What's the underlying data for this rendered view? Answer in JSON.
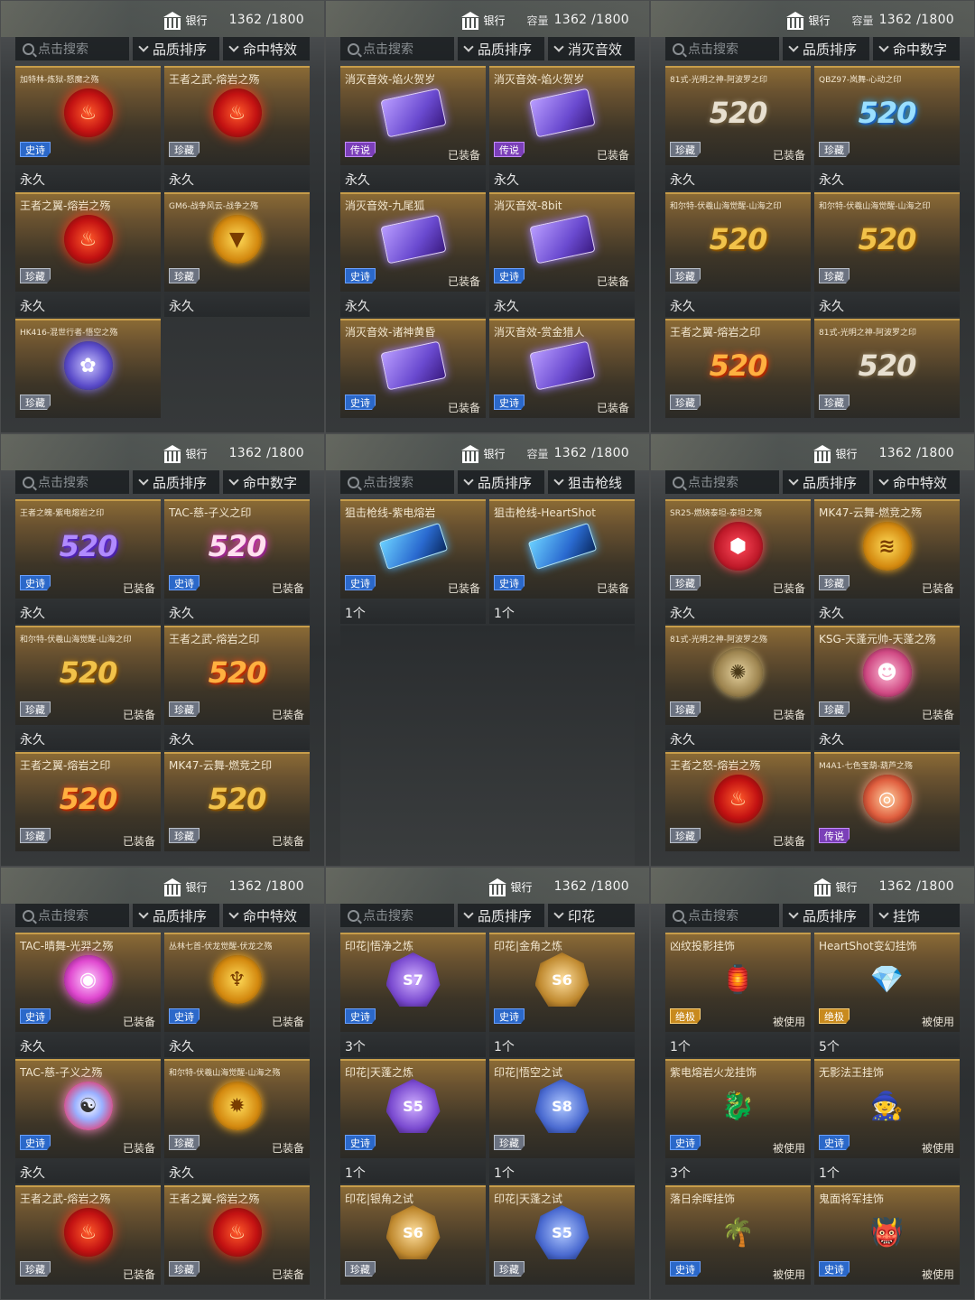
{
  "panels": [
    {
      "bank": "银行",
      "capacity_label": "",
      "capacity": "1362 /1800",
      "search_placeholder": "点击搜索",
      "sort": "品质排序",
      "filter": "命中特效",
      "cards": [
        {
          "name": "加特林-炼狱-怒魔之殇",
          "small": true,
          "art": "emblem",
          "cls": "e-fire",
          "glyph": "♨",
          "badge": "史诗",
          "badge_cls": "b-shishi",
          "equip": "",
          "foot": "永久"
        },
        {
          "name": "王者之武-熔岩之殇",
          "small": false,
          "art": "emblem",
          "cls": "e-fire",
          "glyph": "♨",
          "badge": "珍藏",
          "badge_cls": "b-zhencang",
          "equip": "",
          "foot": "永久"
        },
        {
          "name": "王者之翼-熔岩之殇",
          "small": false,
          "art": "emblem",
          "cls": "e-fire",
          "glyph": "♨",
          "badge": "珍藏",
          "badge_cls": "b-zhencang",
          "equip": "",
          "foot": "永久"
        },
        {
          "name": "GM6-战争风云-战争之殇",
          "small": true,
          "art": "emblem",
          "cls": "e-gold",
          "glyph": "▼",
          "badge": "珍藏",
          "badge_cls": "b-zhencang",
          "equip": "",
          "foot": "永久"
        },
        {
          "name": "HK416-混世行者-悟空之殇",
          "small": true,
          "art": "emblem",
          "cls": "e-blue",
          "glyph": "✿",
          "badge": "珍藏",
          "badge_cls": "b-zhencang",
          "equip": "",
          "foot": ""
        }
      ]
    },
    {
      "bank": "银行",
      "capacity_label": "容量",
      "capacity": "1362 /1800",
      "search_placeholder": "点击搜索",
      "sort": "品质排序",
      "filter": "消灭音效",
      "cards": [
        {
          "name": "消灭音效-焰火贺岁",
          "small": false,
          "art": "sfx",
          "cls": "",
          "glyph": "",
          "badge": "传说",
          "badge_cls": "b-chuanshuo",
          "equip": "已装备",
          "foot": "永久"
        },
        {
          "name": "消灭音效-焰火贺岁",
          "small": false,
          "art": "sfx",
          "cls": "",
          "glyph": "",
          "badge": "传说",
          "badge_cls": "b-chuanshuo",
          "equip": "已装备",
          "foot": "永久"
        },
        {
          "name": "消灭音效-九尾狐",
          "small": false,
          "art": "sfx",
          "cls": "",
          "glyph": "",
          "badge": "史诗",
          "badge_cls": "b-shishi",
          "equip": "已装备",
          "foot": "永久"
        },
        {
          "name": "消灭音效-8bit",
          "small": false,
          "art": "sfx",
          "cls": "",
          "glyph": "",
          "badge": "史诗",
          "badge_cls": "b-shishi",
          "equip": "已装备",
          "foot": "永久"
        },
        {
          "name": "消灭音效-诸神黄昏",
          "small": false,
          "art": "sfx",
          "cls": "",
          "glyph": "",
          "badge": "史诗",
          "badge_cls": "b-shishi",
          "equip": "已装备",
          "foot": ""
        },
        {
          "name": "消灭音效-赏金猎人",
          "small": false,
          "art": "sfx",
          "cls": "",
          "glyph": "",
          "badge": "史诗",
          "badge_cls": "b-shishi",
          "equip": "已装备",
          "foot": ""
        }
      ]
    },
    {
      "bank": "银行",
      "capacity_label": "容量",
      "capacity": "1362 /1800",
      "search_placeholder": "点击搜索",
      "sort": "品质排序",
      "filter": "命中数字",
      "cards": [
        {
          "name": "81式-光明之神-阿波罗之印",
          "small": true,
          "art": "num",
          "cls": "t-silver",
          "glyph": "520",
          "badge": "珍藏",
          "badge_cls": "b-zhencang",
          "equip": "已装备",
          "foot": "永久"
        },
        {
          "name": "QBZ97-岚舞-心动之印",
          "small": true,
          "art": "num",
          "cls": "t-blue",
          "glyph": "520",
          "badge": "珍藏",
          "badge_cls": "b-zhencang",
          "equip": "",
          "foot": "永久"
        },
        {
          "name": "和尔特-伏羲山海觉醒-山海之印",
          "small": true,
          "art": "num",
          "cls": "t-gold",
          "glyph": "520",
          "badge": "珍藏",
          "badge_cls": "b-zhencang",
          "equip": "",
          "foot": "永久"
        },
        {
          "name": "和尔特-伏羲山海觉醒-山海之印",
          "small": true,
          "art": "num",
          "cls": "t-gold",
          "glyph": "520",
          "badge": "珍藏",
          "badge_cls": "b-zhencang",
          "equip": "",
          "foot": "永久"
        },
        {
          "name": "王者之翼-熔岩之印",
          "small": false,
          "art": "num",
          "cls": "t-orange",
          "glyph": "520",
          "badge": "珍藏",
          "badge_cls": "b-zhencang",
          "equip": "",
          "foot": ""
        },
        {
          "name": "81式-光明之神-阿波罗之印",
          "small": true,
          "art": "num",
          "cls": "t-silver",
          "glyph": "520",
          "badge": "珍藏",
          "badge_cls": "b-zhencang",
          "equip": "",
          "foot": ""
        }
      ]
    },
    {
      "bank": "银行",
      "capacity_label": "",
      "capacity": "1362 /1800",
      "search_placeholder": "点击搜索",
      "sort": "品质排序",
      "filter": "命中数字",
      "cards": [
        {
          "name": "王者之魄-紫电熔岩之印",
          "small": true,
          "art": "num",
          "cls": "t-purple",
          "glyph": "520",
          "badge": "史诗",
          "badge_cls": "b-shishi",
          "equip": "已装备",
          "foot": "永久"
        },
        {
          "name": "TAC-慈-子义之印",
          "small": false,
          "art": "num",
          "cls": "t-pink",
          "glyph": "520",
          "badge": "史诗",
          "badge_cls": "b-shishi",
          "equip": "已装备",
          "foot": "永久"
        },
        {
          "name": "和尔特-伏羲山海觉醒-山海之印",
          "small": true,
          "art": "num",
          "cls": "t-gold",
          "glyph": "520",
          "badge": "珍藏",
          "badge_cls": "b-zhencang",
          "equip": "已装备",
          "foot": "永久"
        },
        {
          "name": "王者之武-熔岩之印",
          "small": false,
          "art": "num",
          "cls": "t-orange",
          "glyph": "520",
          "badge": "珍藏",
          "badge_cls": "b-zhencang",
          "equip": "已装备",
          "foot": "永久"
        },
        {
          "name": "王者之翼-熔岩之印",
          "small": false,
          "art": "num",
          "cls": "t-orange",
          "glyph": "520",
          "badge": "珍藏",
          "badge_cls": "b-zhencang",
          "equip": "已装备",
          "foot": ""
        },
        {
          "name": "MK47-云舞-燃竞之印",
          "small": false,
          "art": "num",
          "cls": "t-gold",
          "glyph": "520",
          "badge": "珍藏",
          "badge_cls": "b-zhencang",
          "equip": "已装备",
          "foot": ""
        }
      ]
    },
    {
      "bank": "银行",
      "capacity_label": "容量",
      "capacity": "1362 /1800",
      "search_placeholder": "点击搜索",
      "sort": "品质排序",
      "filter": "狙击枪线",
      "cards": [
        {
          "name": "狙击枪线-紫电熔岩",
          "small": false,
          "art": "snipe",
          "cls": "",
          "glyph": "",
          "badge": "史诗",
          "badge_cls": "b-shishi",
          "equip": "已装备",
          "foot": "1个"
        },
        {
          "name": "狙击枪线-HeartShot",
          "small": false,
          "art": "snipe",
          "cls": "",
          "glyph": "",
          "badge": "史诗",
          "badge_cls": "b-shishi",
          "equip": "已装备",
          "foot": "1个"
        }
      ]
    },
    {
      "bank": "银行",
      "capacity_label": "",
      "capacity": "1362 /1800",
      "search_placeholder": "点击搜索",
      "sort": "品质排序",
      "filter": "命中特效",
      "cards": [
        {
          "name": "SR25-燃烧泰坦-泰坦之殇",
          "small": true,
          "art": "emblem",
          "cls": "e-red2",
          "glyph": "⬢",
          "badge": "珍藏",
          "badge_cls": "b-zhencang",
          "equip": "已装备",
          "foot": "永久"
        },
        {
          "name": "MK47-云舞-燃竞之殇",
          "small": false,
          "art": "emblem",
          "cls": "e-gold",
          "glyph": "≋",
          "badge": "珍藏",
          "badge_cls": "b-zhencang",
          "equip": "已装备",
          "foot": "永久"
        },
        {
          "name": "81式-光明之神-阿波罗之殇",
          "small": true,
          "art": "emblem",
          "cls": "e-bronze",
          "glyph": "✺",
          "badge": "珍藏",
          "badge_cls": "b-zhencang",
          "equip": "已装备",
          "foot": "永久"
        },
        {
          "name": "KSG-天蓬元帅-天蓬之殇",
          "small": false,
          "art": "emblem",
          "cls": "e-pink",
          "glyph": "☻",
          "badge": "珍藏",
          "badge_cls": "b-zhencang",
          "equip": "已装备",
          "foot": "永久"
        },
        {
          "name": "王者之怒-熔岩之殇",
          "small": false,
          "art": "emblem",
          "cls": "e-fire",
          "glyph": "♨",
          "badge": "珍藏",
          "badge_cls": "b-zhencang",
          "equip": "已装备",
          "foot": ""
        },
        {
          "name": "M4A1-七色宝葫-葫芦之殇",
          "small": true,
          "art": "emblem",
          "cls": "e-fire2",
          "glyph": "◎",
          "badge": "传说",
          "badge_cls": "b-chuanshuo",
          "equip": "",
          "foot": ""
        }
      ]
    },
    {
      "bank": "银行",
      "capacity_label": "",
      "capacity": "1362 /1800",
      "search_placeholder": "点击搜索",
      "sort": "品质排序",
      "filter": "命中特效",
      "cards": [
        {
          "name": "TAC-晴舞-光羿之殇",
          "small": false,
          "art": "emblem",
          "cls": "e-magenta",
          "glyph": "◉",
          "badge": "史诗",
          "badge_cls": "b-shishi",
          "equip": "已装备",
          "foot": "永久"
        },
        {
          "name": "丛林七首-伏龙觉醒-伏龙之殇",
          "small": true,
          "art": "emblem",
          "cls": "e-gold",
          "glyph": "♆",
          "badge": "史诗",
          "badge_cls": "b-shishi",
          "equip": "已装备",
          "foot": "永久"
        },
        {
          "name": "TAC-慈-子义之殇",
          "small": false,
          "art": "emblem",
          "cls": "e-ying",
          "glyph": "☯",
          "badge": "史诗",
          "badge_cls": "b-shishi",
          "equip": "已装备",
          "foot": "永久"
        },
        {
          "name": "和尔特-伏羲山海觉醒-山海之殇",
          "small": true,
          "art": "emblem",
          "cls": "e-gold",
          "glyph": "✹",
          "badge": "珍藏",
          "badge_cls": "b-zhencang",
          "equip": "已装备",
          "foot": "永久"
        },
        {
          "name": "王者之武-熔岩之殇",
          "small": false,
          "art": "emblem",
          "cls": "e-fire",
          "glyph": "♨",
          "badge": "珍藏",
          "badge_cls": "b-zhencang",
          "equip": "已装备",
          "foot": ""
        },
        {
          "name": "王者之翼-熔岩之殇",
          "small": false,
          "art": "emblem",
          "cls": "e-fire",
          "glyph": "♨",
          "badge": "珍藏",
          "badge_cls": "b-zhencang",
          "equip": "已装备",
          "foot": ""
        }
      ]
    },
    {
      "bank": "银行",
      "capacity_label": "",
      "capacity": "1362 /1800",
      "search_placeholder": "点击搜索",
      "sort": "品质排序",
      "filter": "印花",
      "cards": [
        {
          "name": "印花|悟净之炼",
          "small": false,
          "art": "stamp",
          "cls": "s-purple",
          "glyph": "S7",
          "badge": "史诗",
          "badge_cls": "b-shishi",
          "equip": "",
          "foot": "3个"
        },
        {
          "name": "印花|金角之炼",
          "small": false,
          "art": "stamp",
          "cls": "s-gold",
          "glyph": "S6",
          "badge": "史诗",
          "badge_cls": "b-shishi",
          "equip": "",
          "foot": "1个"
        },
        {
          "name": "印花|天蓬之炼",
          "small": false,
          "art": "stamp",
          "cls": "s-purple",
          "glyph": "S5",
          "badge": "史诗",
          "badge_cls": "b-shishi",
          "equip": "",
          "foot": "1个"
        },
        {
          "name": "印花|悟空之试",
          "small": false,
          "art": "stamp",
          "cls": "s-blue",
          "glyph": "S8",
          "badge": "珍藏",
          "badge_cls": "b-zhencang",
          "equip": "",
          "foot": "1个"
        },
        {
          "name": "印花|银角之试",
          "small": false,
          "art": "stamp",
          "cls": "s-gold",
          "glyph": "S6",
          "badge": "珍藏",
          "badge_cls": "b-zhencang",
          "equip": "",
          "foot": ""
        },
        {
          "name": "印花|天蓬之试",
          "small": false,
          "art": "stamp",
          "cls": "s-blue",
          "glyph": "S5",
          "badge": "珍藏",
          "badge_cls": "b-zhencang",
          "equip": "",
          "foot": ""
        }
      ]
    },
    {
      "bank": "银行",
      "capacity_label": "",
      "capacity": "1362 /1800",
      "search_placeholder": "点击搜索",
      "sort": "品质排序",
      "filter": "挂饰",
      "cards": [
        {
          "name": "凶纹投影挂饰",
          "small": false,
          "art": "pend",
          "cls": "",
          "glyph": "🏮",
          "badge": "绝极",
          "badge_cls": "b-juepin",
          "equip": "被使用",
          "foot": "1个"
        },
        {
          "name": "HeartShot变幻挂饰",
          "small": false,
          "art": "pend",
          "cls": "",
          "glyph": "💎",
          "badge": "绝极",
          "badge_cls": "b-juepin",
          "equip": "被使用",
          "foot": "5个"
        },
        {
          "name": "紫电熔岩火龙挂饰",
          "small": false,
          "art": "pend",
          "cls": "",
          "glyph": "🐉",
          "badge": "史诗",
          "badge_cls": "b-shishi",
          "equip": "被使用",
          "foot": "3个"
        },
        {
          "name": "无影法王挂饰",
          "small": false,
          "art": "pend",
          "cls": "",
          "glyph": "🧙",
          "badge": "史诗",
          "badge_cls": "b-shishi",
          "equip": "被使用",
          "foot": "1个"
        },
        {
          "name": "落日余晖挂饰",
          "small": false,
          "art": "pend",
          "cls": "",
          "glyph": "🌴",
          "badge": "史诗",
          "badge_cls": "b-shishi",
          "equip": "被使用",
          "foot": ""
        },
        {
          "name": "鬼面将军挂饰",
          "small": false,
          "art": "pend",
          "cls": "",
          "glyph": "👹",
          "badge": "史诗",
          "badge_cls": "b-shishi",
          "equip": "被使用",
          "foot": ""
        }
      ]
    }
  ]
}
